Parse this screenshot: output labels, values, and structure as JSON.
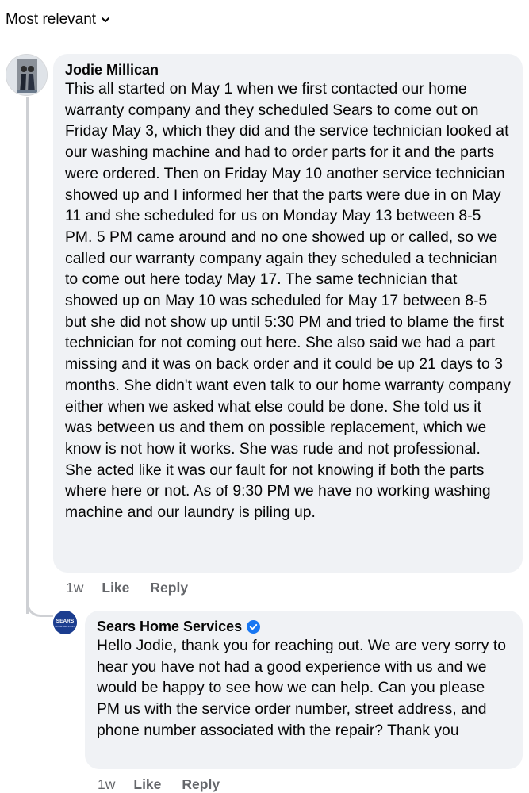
{
  "sort": {
    "label": "Most relevant"
  },
  "comments": [
    {
      "author": "Jodie Millican",
      "text": "This all started on May 1 when we first contacted our home warranty company and they scheduled Sears to come out on Friday May 3, which they did and the service technician looked at our washing machine and had to order parts for it and the parts were ordered.  Then on Friday May 10 another service technician showed up and I informed her that the parts were due in on May 11 and she scheduled for us on Monday May 13 between 8-5 PM.  5 PM came around and no one showed up or called, so we called our warranty company again they scheduled a technician to come out here today May 17. The same technician that showed up on May 10 was scheduled for May 17 between 8-5 but she did not show up until 5:30 PM and tried to blame the first technician for not coming out here.  She also said we had a part missing and it was on back order and it could be up 21 days to 3 months.  She didn't want even talk to our home warranty company either when we asked what else could be done. She told us it was between us and them on possible replacement, which we know is not how it works. She was rude and not professional. She acted like it was our fault for not knowing if both the parts where here or not.  As of 9:30 PM we have no working washing machine and our laundry is piling up.",
      "time": "1w",
      "like": "Like",
      "reply": "Reply"
    },
    {
      "author": "Sears Home Services",
      "verified": true,
      "text": "Hello Jodie, thank you for reaching out. We are very sorry to hear you have not had a good experience with us and we would be happy to see how we can help. Can you please PM us with the service order number, street address, and phone number associated with the repair? Thank you",
      "time": "1w",
      "like": "Like",
      "reply": "Reply",
      "avatar_text": "SEARS HOME SERVICES"
    }
  ],
  "colors": {
    "bubble": "#f0f2f5",
    "meta": "#65676b",
    "verified": "#1877f2",
    "thread": "#ced0d4"
  }
}
